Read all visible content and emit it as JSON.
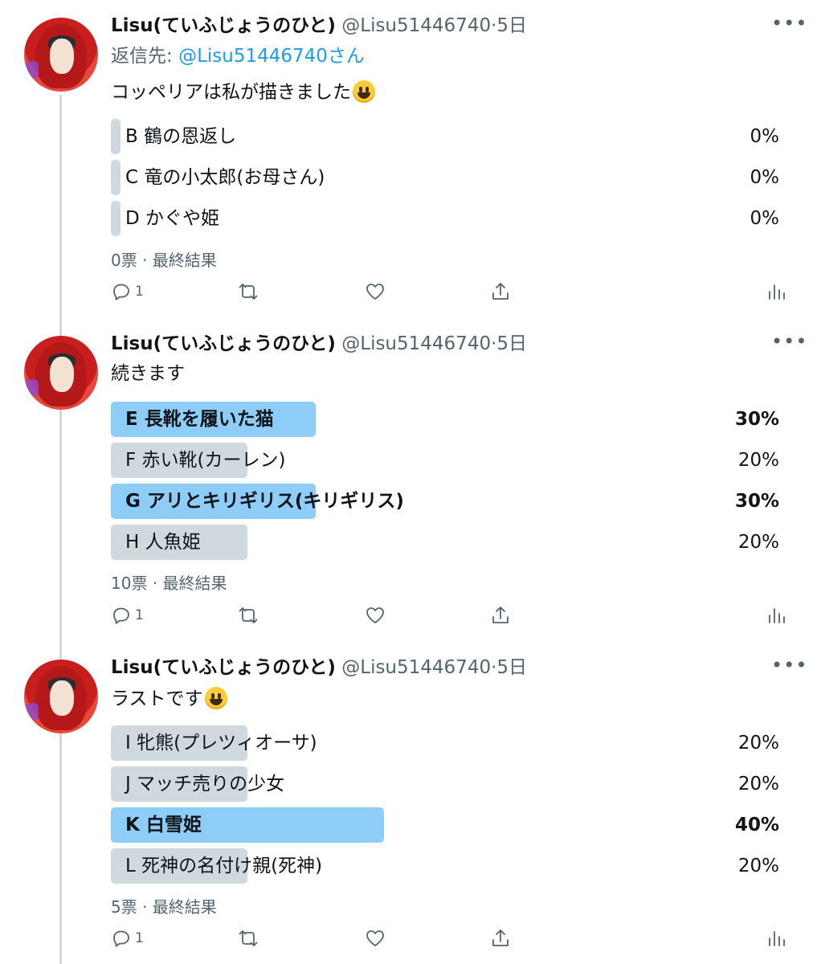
{
  "tweets": [
    {
      "name": "Lisu(ていふじょうのひと)",
      "handle": "@Lisu51446740",
      "sep": "·",
      "time": "5日",
      "reply_prefix": "返信先: ",
      "reply_to": "@Lisu51446740さん",
      "text": "コッペリアは私が描きました",
      "emoji": "grinning-face",
      "poll": [
        {
          "label": "B 鶴の恩返し",
          "percent": "0%",
          "fraction": 0.0,
          "winner": false
        },
        {
          "label": "C 竜の小太郎(お母さん)",
          "percent": "0%",
          "fraction": 0.0,
          "winner": false
        },
        {
          "label": "D かぐや姫",
          "percent": "0%",
          "fraction": 0.0,
          "winner": false
        }
      ],
      "poll_meta": "0票 · 最終結果",
      "reply_count": "1"
    },
    {
      "name": "Lisu(ていふじょうのひと)",
      "handle": "@Lisu51446740",
      "sep": "·",
      "time": "5日",
      "text": "続きます",
      "poll": [
        {
          "label": "E 長靴を履いた猫",
          "percent": "30%",
          "fraction": 0.3,
          "winner": true
        },
        {
          "label": "F 赤い靴(カーレン)",
          "percent": "20%",
          "fraction": 0.2,
          "winner": false
        },
        {
          "label": "G アリとキリギリス(キリギリス)",
          "percent": "30%",
          "fraction": 0.3,
          "winner": true
        },
        {
          "label": "H 人魚姫",
          "percent": "20%",
          "fraction": 0.2,
          "winner": false
        }
      ],
      "poll_meta": "10票 · 最終結果",
      "reply_count": "1"
    },
    {
      "name": "Lisu(ていふじょうのひと)",
      "handle": "@Lisu51446740",
      "sep": "·",
      "time": "5日",
      "text": "ラストです",
      "emoji": "grinning-face",
      "poll": [
        {
          "label": "I 牝熊(プレツィオーサ)",
          "percent": "20%",
          "fraction": 0.2,
          "winner": false
        },
        {
          "label": "J マッチ売りの少女",
          "percent": "20%",
          "fraction": 0.2,
          "winner": false
        },
        {
          "label": "K 白雪姫",
          "percent": "40%",
          "fraction": 0.4,
          "winner": true
        },
        {
          "label": "L 死神の名付け親(死神)",
          "percent": "20%",
          "fraction": 0.2,
          "winner": false
        }
      ],
      "poll_meta": "5票 · 最終結果",
      "reply_count": "1"
    }
  ],
  "icons": [
    "more-icon",
    "reply-icon",
    "retweet-icon",
    "like-icon",
    "share-icon",
    "analytics-icon"
  ],
  "colors": {
    "winner_bar": "#8ecdf8",
    "other_bar": "#cfd9de",
    "link": "#1d9bf0",
    "secondary_text": "#536471",
    "thread_line": "#cfd9de"
  }
}
